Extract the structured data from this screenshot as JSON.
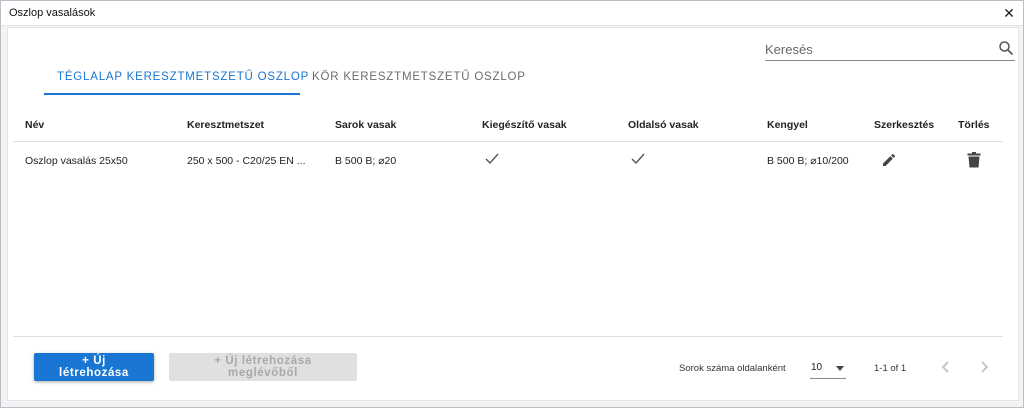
{
  "window": {
    "title": "Oszlop vasalások",
    "close_glyph": "✕"
  },
  "search": {
    "placeholder": "Keresés",
    "value": ""
  },
  "tabs": [
    {
      "label": "Téglalap keresztmetszetű oszlop",
      "active": true
    },
    {
      "label": "Kör keresztmetszetű oszlop",
      "active": false
    }
  ],
  "table": {
    "columns": [
      "Név",
      "Keresztmetszet",
      "Sarok vasak",
      "Kiegészítő vasak",
      "Oldalsó vasak",
      "Kengyel",
      "Szerkesztés",
      "Törlés"
    ],
    "rows": [
      {
        "name": "Oszlop vasalás 25x50",
        "cross_section": "250 x 500 - C20/25 EN ...",
        "corner_bars": "B 500 B; ⌀20",
        "supplementary_bars": true,
        "side_bars": true,
        "stirrup": "B 500 B; ⌀10/200"
      }
    ]
  },
  "footer": {
    "create_button": "+ Új létrehozása",
    "create_from_existing_button": "+ Új létrehozása meglévőből",
    "rows_per_page_label": "Sorok száma oldalanként",
    "rows_per_page_value": "10",
    "range": "1-1 of 1"
  },
  "colors": {
    "accent": "#1976d2",
    "disabled_bg": "#e0e0e0",
    "disabled_text": "#a9a9a9"
  },
  "icons": [
    "close-icon",
    "search-icon",
    "check-icon",
    "pencil-icon",
    "trash-icon",
    "caret-down-icon",
    "chevron-left-icon",
    "chevron-right-icon"
  ]
}
